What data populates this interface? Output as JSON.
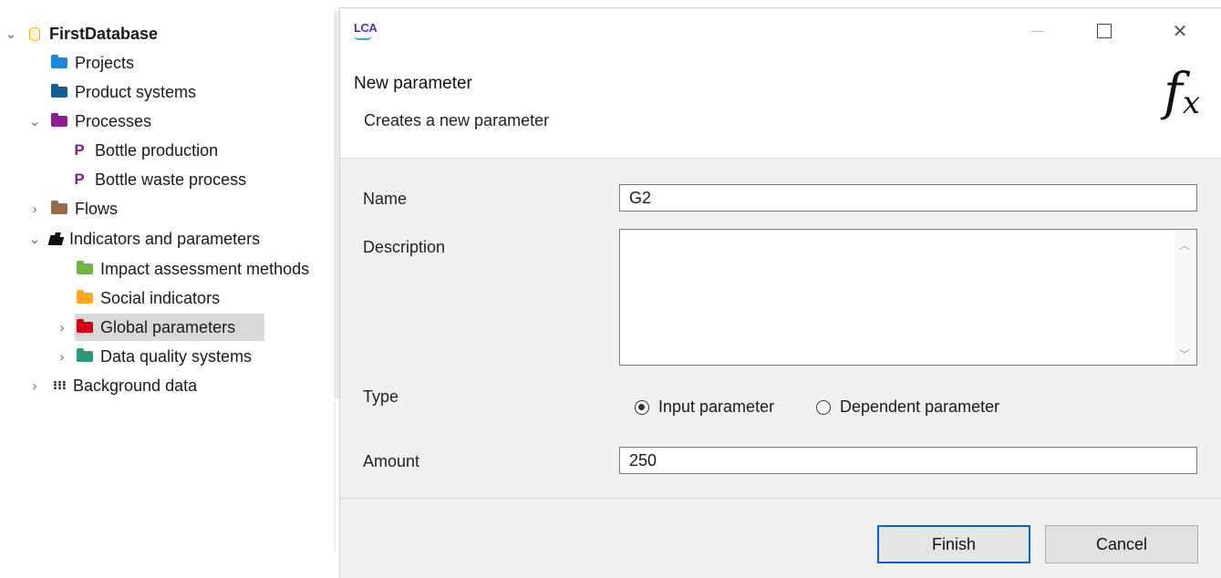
{
  "tree": {
    "root_label": "FirstDatabase",
    "items": [
      {
        "label": "Projects",
        "color": "#1c87d8"
      },
      {
        "label": "Product systems",
        "color": "#155e93"
      },
      {
        "label": "Processes",
        "color": "#8b1d8e"
      },
      {
        "label": "Bottle production"
      },
      {
        "label": "Bottle waste process"
      },
      {
        "label": "Flows",
        "color": "#9b6a4b"
      },
      {
        "label": "Indicators and parameters"
      },
      {
        "label": "Impact assessment methods",
        "color": "#6fb544"
      },
      {
        "label": "Social indicators",
        "color": "#ffa623"
      },
      {
        "label": "Global parameters",
        "color": "#d40014"
      },
      {
        "label": "Data quality systems",
        "color": "#2a9a7e"
      },
      {
        "label": "Background data"
      }
    ]
  },
  "dialog": {
    "logo_text": "LCA",
    "header_title": "New parameter",
    "header_subtitle": "Creates a new parameter",
    "fx_symbol": "f",
    "fx_sub": "x",
    "name_label": "Name",
    "name_value": "G2",
    "description_label": "Description",
    "description_value": "",
    "type_label": "Type",
    "type_options": [
      "Input parameter",
      "Dependent parameter"
    ],
    "type_selected": "Input parameter",
    "amount_label": "Amount",
    "amount_value": "250",
    "finish_label": "Finish",
    "cancel_label": "Cancel",
    "close_symbol": "✕"
  }
}
